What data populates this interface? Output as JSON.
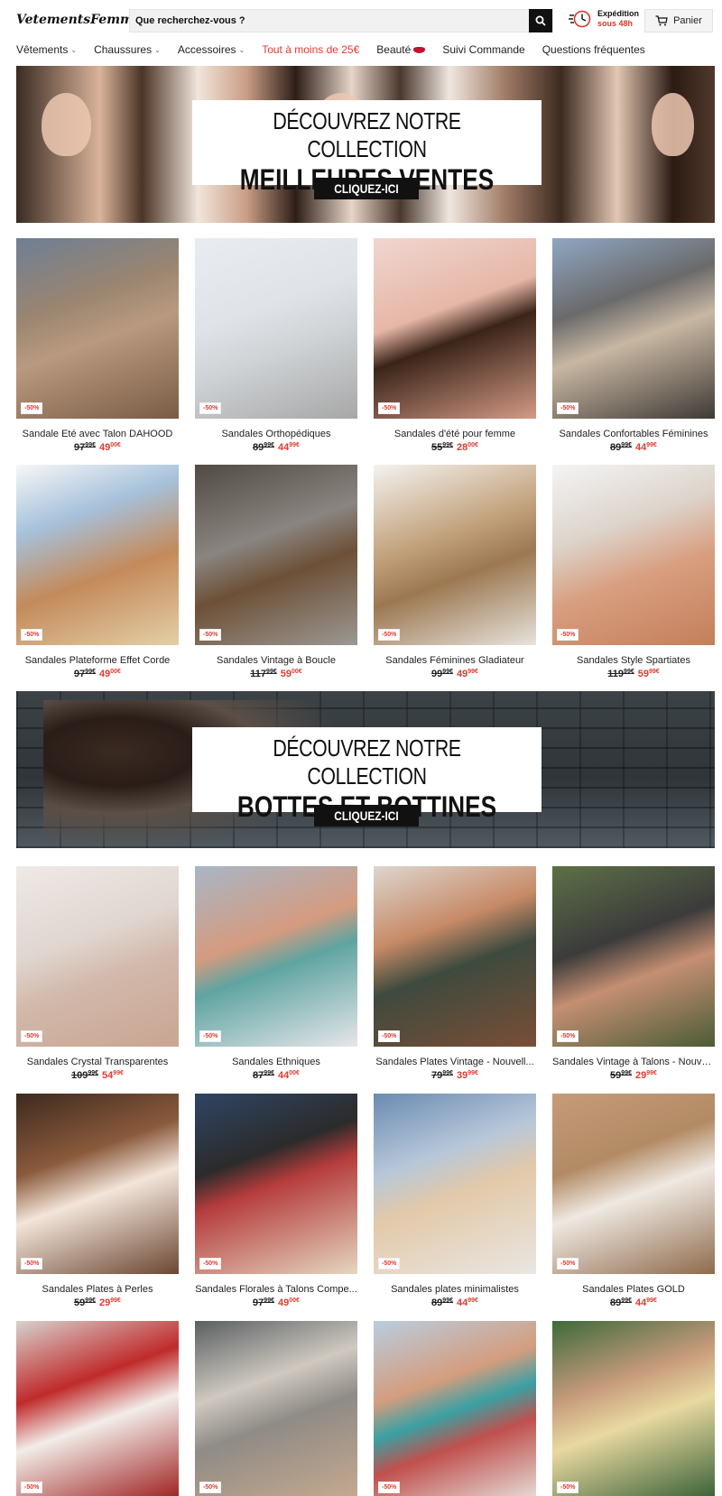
{
  "header": {
    "logo_text": "VetementsFemmes",
    "search_placeholder": "Que recherchez-vous ?",
    "shipping_line1": "Expédition",
    "shipping_line2": "sous 48h",
    "cart_label": "Panier"
  },
  "nav": [
    {
      "label": "Vêtements",
      "has_dropdown": true
    },
    {
      "label": "Chaussures",
      "has_dropdown": true
    },
    {
      "label": "Accessoires",
      "has_dropdown": true
    },
    {
      "label": "Tout à moins de 25€",
      "has_dropdown": false,
      "highlight": "#e03b2f"
    },
    {
      "label": "Beauté",
      "has_dropdown": false,
      "icon": "lips-icon"
    },
    {
      "label": "Suivi Commande",
      "has_dropdown": false
    },
    {
      "label": "Questions fréquentes",
      "has_dropdown": false
    }
  ],
  "banners": [
    {
      "line1": "DÉCOUVREZ NOTRE COLLECTION",
      "line2": "MEILLEURES VENTES",
      "cta": "CLIQUEZ-ICI"
    },
    {
      "line1": "DÉCOUVREZ NOTRE COLLECTION",
      "line2": "BOTTES ET BOTTINES",
      "cta": "CLIQUEZ-ICI"
    }
  ],
  "badge_label": "-50%",
  "currency": "€",
  "products": [
    {
      "title": "Sandale Eté avec Talon DAHOOD",
      "old_main": "97",
      "old_cents": "99",
      "new_main": "49",
      "new_cents": "00"
    },
    {
      "title": "Sandales Orthopédiques",
      "old_main": "89",
      "old_cents": "99",
      "new_main": "44",
      "new_cents": "99"
    },
    {
      "title": "Sandales d'été pour femme",
      "old_main": "55",
      "old_cents": "99",
      "new_main": "28",
      "new_cents": "00"
    },
    {
      "title": "Sandales Confortables Féminines",
      "old_main": "89",
      "old_cents": "99",
      "new_main": "44",
      "new_cents": "99"
    },
    {
      "title": "Sandales Plateforme Effet Corde",
      "old_main": "97",
      "old_cents": "99",
      "new_main": "49",
      "new_cents": "00"
    },
    {
      "title": "Sandales Vintage à Boucle",
      "old_main": "117",
      "old_cents": "99",
      "new_main": "59",
      "new_cents": "00"
    },
    {
      "title": "Sandales Féminines Gladiateur",
      "old_main": "99",
      "old_cents": "99",
      "new_main": "49",
      "new_cents": "99"
    },
    {
      "title": "Sandales Style Spartiates",
      "old_main": "119",
      "old_cents": "99",
      "new_main": "59",
      "new_cents": "99"
    },
    {
      "title": "Sandales Crystal Transparentes",
      "old_main": "109",
      "old_cents": "99",
      "new_main": "54",
      "new_cents": "99"
    },
    {
      "title": "Sandales Ethniques",
      "old_main": "87",
      "old_cents": "99",
      "new_main": "44",
      "new_cents": "00"
    },
    {
      "title": "Sandales Plates Vintage - Nouvell...",
      "old_main": "79",
      "old_cents": "99",
      "new_main": "39",
      "new_cents": "99"
    },
    {
      "title": "Sandales Vintage à Talons - Nouve...",
      "old_main": "59",
      "old_cents": "99",
      "new_main": "29",
      "new_cents": "99"
    },
    {
      "title": "Sandales Plates à Perles",
      "old_main": "59",
      "old_cents": "99",
      "new_main": "29",
      "new_cents": "99"
    },
    {
      "title": "Sandales Florales à Talons Compe...",
      "old_main": "97",
      "old_cents": "99",
      "new_main": "49",
      "new_cents": "00"
    },
    {
      "title": "Sandales plates minimalistes",
      "old_main": "89",
      "old_cents": "99",
      "new_main": "44",
      "new_cents": "99"
    },
    {
      "title": "Sandales Plates GOLD",
      "old_main": "89",
      "old_cents": "99",
      "new_main": "44",
      "new_cents": "99"
    },
    {
      "title": "",
      "old_main": "",
      "old_cents": "",
      "new_main": "",
      "new_cents": ""
    },
    {
      "title": "",
      "old_main": "",
      "old_cents": "",
      "new_main": "",
      "new_cents": ""
    },
    {
      "title": "",
      "old_main": "",
      "old_cents": "",
      "new_main": "",
      "new_cents": ""
    },
    {
      "title": "",
      "old_main": "",
      "old_cents": "",
      "new_main": "",
      "new_cents": ""
    }
  ],
  "colors": {
    "accent": "#e03b2f",
    "dark": "#111111"
  }
}
